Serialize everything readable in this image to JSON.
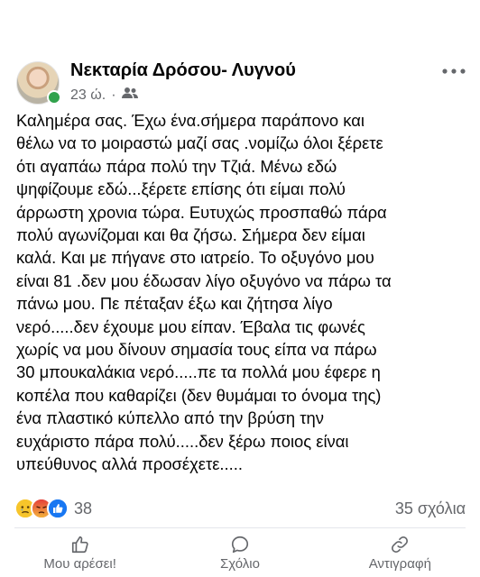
{
  "post": {
    "author": "Νεκταρία Δρόσου- Λυγνού",
    "time": "23 ώ.",
    "separator": "·",
    "text": "Καλημέρα σας. Έχω ένα.σήμερα παράπονο και\nθέλω να το μοιραστώ μαζί σας .νομίζω όλοι ξέρετε\nότι αγαπάω πάρα πολύ την Τζιά. Μένω εδώ\nψηφίζουμε εδώ...ξέρετε επίσης ότι είμαι πολύ\nάρρωστη χρονια τώρα. Ευτυχώς προσπαθώ πάρα\nπολύ αγωνίζομαι και θα ζήσω. Σήμερα δεν είμαι\nκαλά. Και με πήγανε στο ιατρείο. Το οξυγόνο μου\nείναι 81 .δεν μου έδωσαν λίγο οξυγόνο να πάρω τα\nπάνω μου. Πε πέταξαν έξω και ζήτησα λίγο\nνερό.....δεν έχουμε μου είπαν. Έβαλα τις φωνές\nχωρίς να μου δίνουν σημασία τους είπα να πάρω\n30 μπουκαλάκια νερό.....πε τα πολλά μου έφερε η\nκοπέλα που καθαρίζει (δεν θυμάμαι το όνομα της)\nένα πλαστικό κύπελλο από την βρύση την\nευχάριστο πάρα πολύ.....δεν ξέρω ποιος είναι\nυπεύθυνος αλλά προσέχετε.....",
    "reaction_count": "38",
    "comment_count": "35 σχόλια",
    "reactions": [
      "sad-icon",
      "angry-icon",
      "like-icon"
    ]
  },
  "actions": {
    "like_label": "Μου αρέσει!",
    "comment_label": "Σχόλιο",
    "share_label": "Αντιγραφή"
  },
  "colors": {
    "secondary_text": "#65676b",
    "online": "#31a24c",
    "like_blue": "#1877f2"
  }
}
